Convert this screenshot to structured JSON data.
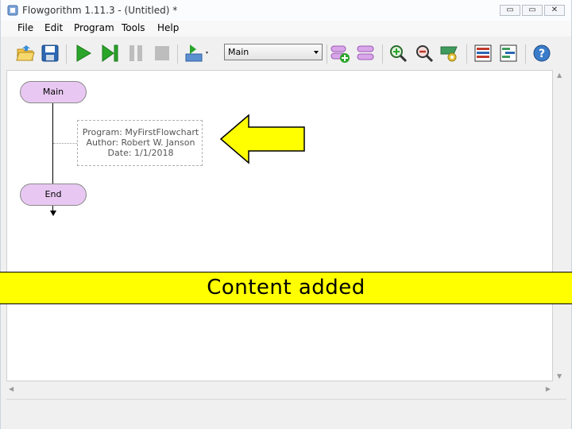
{
  "window": {
    "title": "Flowgorithm 1.11.3 - (Untitled) *",
    "controls": {
      "minimize": "▭",
      "maximize": "▭",
      "close": "✕"
    }
  },
  "menu": [
    "File",
    "Edit",
    "Program",
    "Tools",
    "Help"
  ],
  "toolbar": {
    "icons": [
      "open-folder-icon",
      "save-icon",
      "run-icon",
      "step-icon",
      "pause-icon",
      "stop-icon",
      "layout-icon",
      "add-function-icon",
      "delete-function-icon",
      "zoom-in-icon",
      "zoom-out-icon",
      "style-icon",
      "variable-watch-icon",
      "console-icon",
      "help-icon"
    ],
    "function_select": "Main"
  },
  "flowchart": {
    "start_label": "Main",
    "end_label": "End",
    "comment": {
      "program": "Program: MyFirstFlowchart",
      "author": "Author:  Robert W. Janson",
      "date": "Date:    1/1/2018"
    }
  },
  "banner": {
    "text": "Content added"
  },
  "colors": {
    "terminal": "#e8c8f2",
    "banner": "#ffff00",
    "arrow": "#ffff00",
    "run_green": "#2aa52a"
  }
}
